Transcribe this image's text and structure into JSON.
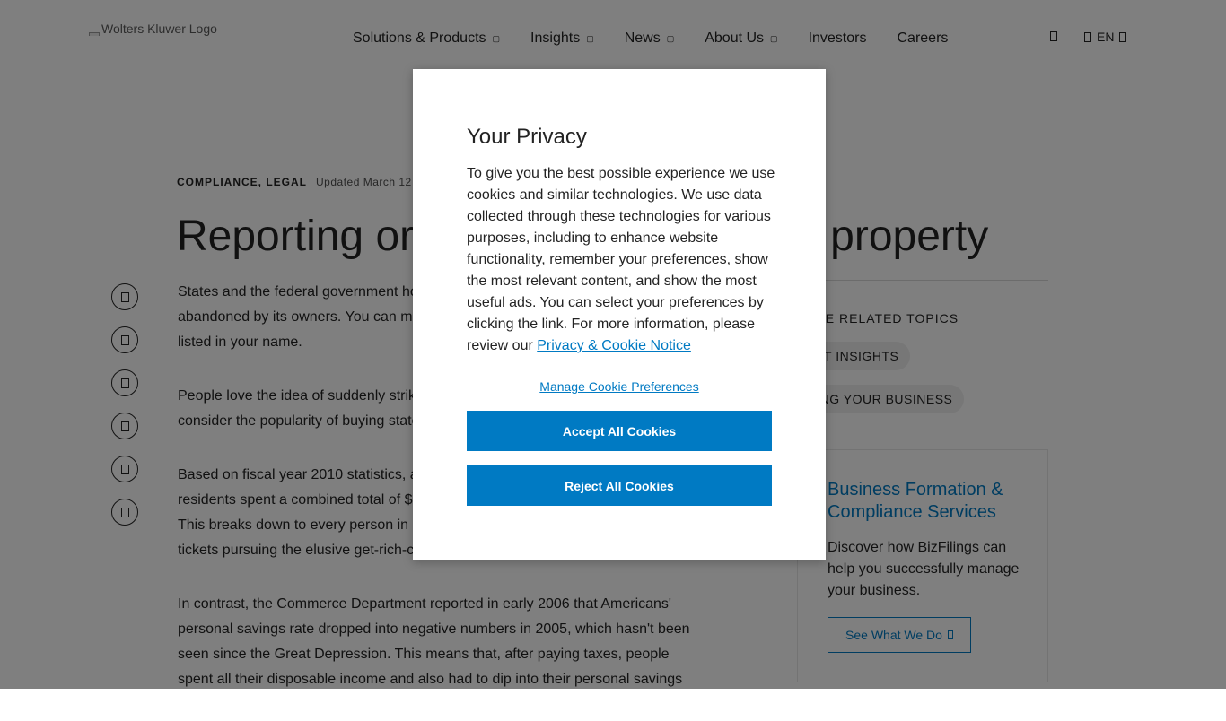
{
  "header": {
    "logo_alt": "Wolters Kluwer Logo",
    "nav": [
      {
        "label": "Solutions & Products",
        "has_dropdown": true
      },
      {
        "label": "Insights",
        "has_dropdown": true
      },
      {
        "label": "News",
        "has_dropdown": true
      },
      {
        "label": "About Us",
        "has_dropdown": true
      },
      {
        "label": "Investors",
        "has_dropdown": false
      },
      {
        "label": "Careers",
        "has_dropdown": false
      }
    ],
    "language": "EN",
    "icons": [
      "search-icon",
      "globe-icon",
      "chevron-down-icon"
    ]
  },
  "article": {
    "tags": "COMPLIANCE, LEGAL",
    "updated": "Updated March 12",
    "title_left": "Reporting or",
    "title_right": "property",
    "share_icons": [
      "facebook-icon",
      "twitter-icon",
      "linkedin-icon",
      "email-icon",
      "print-icon",
      "share-icon"
    ],
    "paragraphs": [
      [
        "States and the federal government ho",
        "abandoned by its owners. You can m",
        "listed in your name."
      ],
      [
        "People love the idea of suddenly strik",
        "consider the popularity of buying state"
      ],
      [
        "Based on fiscal year 2010 statistics, a",
        "residents spent a combined total of $",
        "This breaks down to every person in",
        "tickets pursuing the elusive get-rich-c"
      ],
      [
        "In contrast, the Commerce Department reported in early 2006 that Americans'",
        "personal savings rate dropped into negative numbers in 2005, which hasn't been",
        "seen since the Great Depression. This means that, after paying taxes, people",
        "spent all their disposable income and also had to dip into their personal savings"
      ]
    ]
  },
  "sidebar": {
    "related_title": "LORE RELATED TOPICS",
    "chips": [
      "PERT INSIGHTS",
      "NNING YOUR BUSINESS"
    ],
    "promo": {
      "title": "Business Formation & Compliance Services",
      "description": "Discover how BizFilings can help you successfully manage your business.",
      "cta": "See What We Do"
    }
  },
  "privacy_modal": {
    "title": "Your Privacy",
    "body": "To give you the best possible experience we use cookies and similar technologies. We use data collected through these technologies for various purposes, including to enhance website functionality, remember your preferences, show the most relevant content, and show the most useful ads. You can select your preferences by clicking the link. For more information, please review our ",
    "notice_link": "Privacy & Cookie Notice",
    "manage_link": "Manage Cookie Preferences",
    "accept_label": "Accept All Cookies",
    "reject_label": "Reject All Cookies"
  },
  "colors": {
    "accent": "#007ac3",
    "overlay": "rgba(0,0,0,0.5)",
    "text": "#232323",
    "chip_bg": "#eeeeee"
  }
}
